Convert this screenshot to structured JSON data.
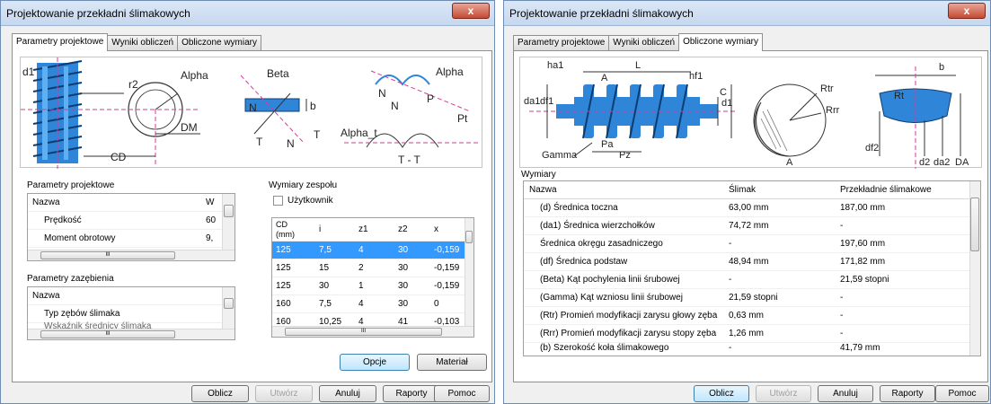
{
  "left_window": {
    "title": "Projektowanie przekładni ślimakowych",
    "close_label": "x",
    "tabs": [
      "Parametry projektowe",
      "Wyniki obliczeń",
      "Obliczone wymiary"
    ],
    "diagram": {
      "labels": [
        "d1",
        "r2",
        "Alpha",
        "DM",
        "CD",
        "Beta",
        "b",
        "T",
        "T",
        "N",
        "N",
        "N",
        "N",
        "Alpha",
        "P",
        "Pt",
        "Alpha_t",
        "T - T"
      ]
    },
    "design_params": {
      "title": "Parametry projektowe",
      "columns": [
        "Nazwa",
        "W"
      ],
      "rows": [
        {
          "name": "Prędkość",
          "value": "60"
        },
        {
          "name": "Moment obrotowy",
          "value": "9,"
        }
      ],
      "scroll_glyph": "III"
    },
    "mesh_params": {
      "title": "Parametry zazębienia",
      "columns": [
        "Nazwa"
      ],
      "rows": [
        {
          "name": "Typ zębów ślimaka"
        },
        {
          "name": "Wskaźnik średnicy ślimaka"
        }
      ],
      "scroll_glyph": "III"
    },
    "assembly": {
      "title": "Wymiary zespołu",
      "user_checkbox_label": "Użytkownik",
      "user_checked": false,
      "columns": [
        "CD (mm)",
        "i",
        "z1",
        "z2",
        "x"
      ],
      "rows": [
        [
          "125",
          "7,5",
          "4",
          "30",
          "-0,159"
        ],
        [
          "125",
          "15",
          "2",
          "30",
          "-0,159"
        ],
        [
          "125",
          "30",
          "1",
          "30",
          "-0,159"
        ],
        [
          "160",
          "7,5",
          "4",
          "30",
          "0"
        ],
        [
          "160",
          "10,25",
          "4",
          "41",
          "-0,103"
        ]
      ],
      "selected_row": 0,
      "scroll_glyph": "III"
    },
    "panel_buttons": {
      "options": "Opcje",
      "material": "Materiał"
    },
    "bottom_buttons": {
      "calculate": "Oblicz",
      "create": "Utwórz",
      "cancel": "Anuluj",
      "reports": "Raporty",
      "help": "Pomoc"
    }
  },
  "right_window": {
    "title": "Projektowanie przekładni ślimakowych",
    "close_label": "x",
    "tabs": [
      "Parametry projektowe",
      "Wyniki obliczeń",
      "Obliczone wymiary"
    ],
    "diagram": {
      "labels": [
        "ha1",
        "L",
        "hf1",
        "A",
        "C",
        "da1",
        "df1",
        "d1",
        "Pa",
        "Pz",
        "Gamma",
        "Rtr",
        "Rrr",
        "A",
        "b",
        "Rt",
        "df2",
        "d2",
        "da2",
        "DA"
      ]
    },
    "dimensions": {
      "title": "Wymiary",
      "columns": [
        "Nazwa",
        "Ślimak",
        "Przekładnie ślimakowe"
      ],
      "rows": [
        {
          "name": "(d) Średnica toczna",
          "worm": "63,00 mm",
          "gear": "187,00 mm"
        },
        {
          "name": "(da1) Średnica wierzchołków",
          "worm": "74,72 mm",
          "gear": "-"
        },
        {
          "name": "Średnica okręgu zasadniczego",
          "worm": "-",
          "gear": "197,60 mm"
        },
        {
          "name": "(df) Średnica podstaw",
          "worm": "48,94 mm",
          "gear": "171,82 mm"
        },
        {
          "name": "(Beta) Kąt pochylenia linii śrubowej",
          "worm": "-",
          "gear": "21,59 stopni"
        },
        {
          "name": "(Gamma) Kąt wzniosu linii śrubowej",
          "worm": "21,59 stopni",
          "gear": "-"
        },
        {
          "name": "(Rtr) Promień modyfikacji zarysu głowy zęba",
          "worm": "0,63 mm",
          "gear": "-"
        },
        {
          "name": "(Rrr) Promień modyfikacji zarysu stopy zęba",
          "worm": "1,26 mm",
          "gear": "-"
        },
        {
          "name": "(b) Szerokość koła ślimakowego",
          "worm": "-",
          "gear": "41,79 mm"
        }
      ]
    },
    "bottom_buttons": {
      "calculate": "Oblicz",
      "create": "Utwórz",
      "cancel": "Anuluj",
      "reports": "Raporty",
      "help": "Pomoc"
    }
  },
  "colors": {
    "accent_blue": "#3399ff",
    "worm_blue": "#2f86d8",
    "dimension_magenta": "#d63b9b",
    "title_bar": "#c6d8ef"
  }
}
